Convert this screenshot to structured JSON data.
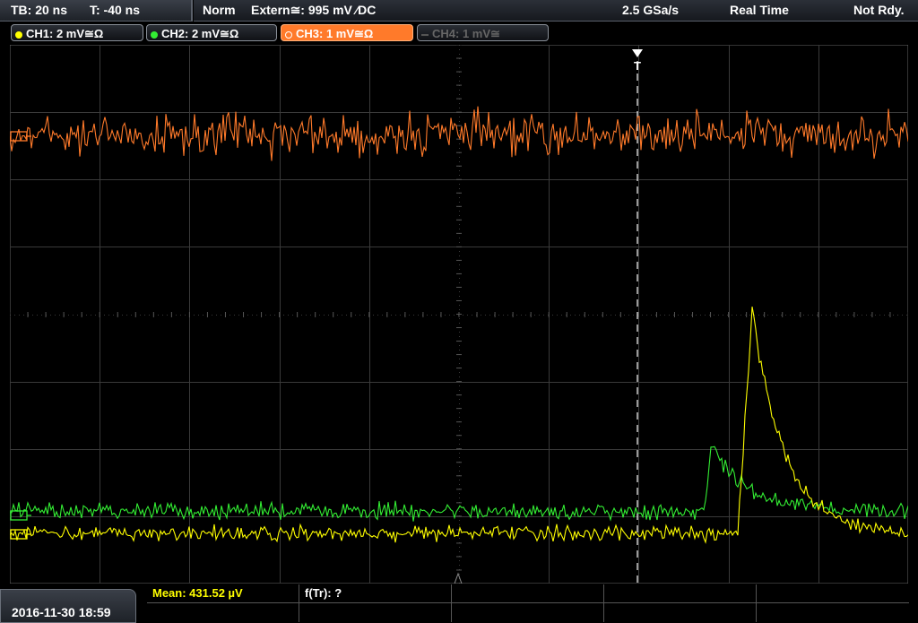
{
  "timebase": {
    "tb": "TB: 20 ns",
    "offset": "T: -40 ns"
  },
  "header": {
    "mode": "Norm",
    "trigger": "Extern≅: 995 mV ⁄DC",
    "sample_rate": "2.5 GSa/s",
    "acq_mode": "Real Time",
    "status": "Not Rdy."
  },
  "channels": [
    {
      "label": "CH1: 2 mV≅Ω",
      "color": "#ffff00",
      "active": true
    },
    {
      "label": "CH2: 2 mV≅Ω",
      "color": "#33ee33",
      "active": true
    },
    {
      "label": "CH3: 1 mV≅Ω",
      "color": "#ff7a2a",
      "active": true,
      "selected": true
    },
    {
      "label": "CH4: 1 mV≅",
      "color": "#666666",
      "active": false
    }
  ],
  "markers": {
    "trigger": "T"
  },
  "measurements": {
    "mean": "Mean: 431.52 µV",
    "freq": "f(Tr): ?"
  },
  "datetime": "2016-11-30 18:59",
  "colors": {
    "ch1": "#ffff00",
    "ch2": "#33ee33",
    "ch3": "#ff7a2a",
    "grid": "#3a3a3a",
    "background": "#000000"
  }
}
